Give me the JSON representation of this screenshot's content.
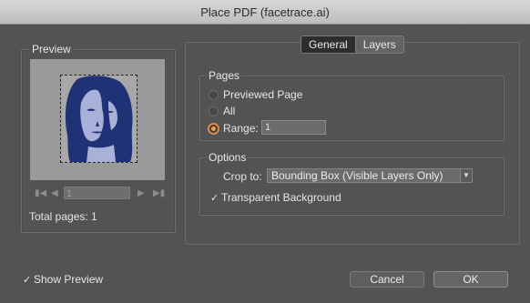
{
  "window": {
    "title": "Place PDF (facetrace.ai)"
  },
  "preview": {
    "legend": "Preview",
    "page_value": "1",
    "total_pages": "Total pages: 1",
    "image_colors": {
      "dark": "#1e3275",
      "light": "#a9b1d8",
      "bg": "#a8a8a8"
    }
  },
  "tabs": {
    "general": "General",
    "layers": "Layers"
  },
  "pages": {
    "legend": "Pages",
    "previewed_page": "Previewed Page",
    "all": "All",
    "range_label": "Range:",
    "range_value": "1",
    "selected": "range"
  },
  "options": {
    "legend": "Options",
    "crop_label": "Crop to:",
    "crop_value": "Bounding Box (Visible Layers Only)",
    "transparent_background": "Transparent Background",
    "transparent_checked": true
  },
  "footer": {
    "show_preview": "Show Preview",
    "show_preview_checked": true,
    "cancel": "Cancel",
    "ok": "OK"
  },
  "colors": {
    "accent": "#f2a055",
    "panel": "#535353"
  }
}
